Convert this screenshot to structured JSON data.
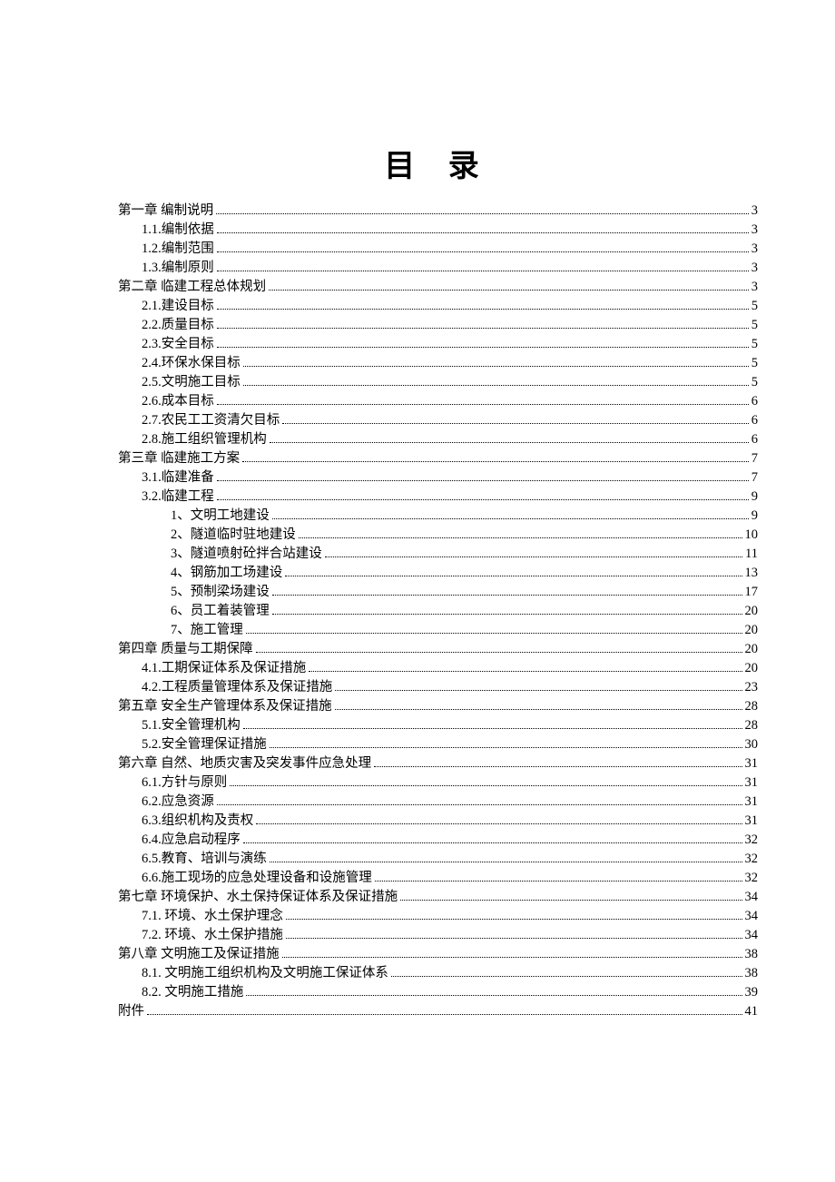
{
  "title": "目 录",
  "toc": [
    {
      "level": 0,
      "label": "第一章  编制说明",
      "page": "3"
    },
    {
      "level": 1,
      "label": "1.1.编制依据",
      "page": "3"
    },
    {
      "level": 1,
      "label": "1.2.编制范围",
      "page": "3"
    },
    {
      "level": 1,
      "label": "1.3.编制原则",
      "page": "3"
    },
    {
      "level": 0,
      "label": "第二章  临建工程总体规划",
      "page": "3"
    },
    {
      "level": 1,
      "label": "2.1.建设目标",
      "page": "5"
    },
    {
      "level": 1,
      "label": "2.2.质量目标",
      "page": "5"
    },
    {
      "level": 1,
      "label": "2.3.安全目标",
      "page": "5"
    },
    {
      "level": 1,
      "label": "2.4.环保水保目标",
      "page": "5"
    },
    {
      "level": 1,
      "label": "2.5.文明施工目标",
      "page": "5"
    },
    {
      "level": 1,
      "label": "2.6.成本目标",
      "page": "6"
    },
    {
      "level": 1,
      "label": "2.7.农民工工资清欠目标",
      "page": "6"
    },
    {
      "level": 1,
      "label": "2.8.施工组织管理机构",
      "page": "6"
    },
    {
      "level": 0,
      "label": "第三章  临建施工方案",
      "page": "7"
    },
    {
      "level": 1,
      "label": "3.1.临建准备",
      "page": "7"
    },
    {
      "level": 1,
      "label": "3.2.临建工程",
      "page": "9"
    },
    {
      "level": 2,
      "label": "1、文明工地建设",
      "page": "9"
    },
    {
      "level": 2,
      "label": "2、隧道临时驻地建设",
      "page": "10"
    },
    {
      "level": 2,
      "label": "3、隧道喷射砼拌合站建设",
      "page": "11"
    },
    {
      "level": 2,
      "label": "4、钢筋加工场建设",
      "page": "13"
    },
    {
      "level": 2,
      "label": "5、预制梁场建设",
      "page": "17"
    },
    {
      "level": 2,
      "label": "6、员工着装管理",
      "page": "20"
    },
    {
      "level": 2,
      "label": "7、施工管理",
      "page": "20"
    },
    {
      "level": 0,
      "label": "第四章  质量与工期保障",
      "page": "20"
    },
    {
      "level": 1,
      "label": "4.1.工期保证体系及保证措施",
      "page": "20"
    },
    {
      "level": 1,
      "label": "4.2.工程质量管理体系及保证措施",
      "page": "23"
    },
    {
      "level": 0,
      "label": "第五章  安全生产管理体系及保证措施",
      "page": "28"
    },
    {
      "level": 1,
      "label": "5.1.安全管理机构",
      "page": "28"
    },
    {
      "level": 1,
      "label": "5.2.安全管理保证措施",
      "page": "30"
    },
    {
      "level": 0,
      "label": "第六章  自然、地质灾害及突发事件应急处理",
      "page": "31"
    },
    {
      "level": 1,
      "label": "6.1.方针与原则",
      "page": "31"
    },
    {
      "level": 1,
      "label": "6.2.应急资源",
      "page": "31"
    },
    {
      "level": 1,
      "label": "6.3.组织机构及责权",
      "page": "31"
    },
    {
      "level": 1,
      "label": "6.4.应急启动程序",
      "page": "32"
    },
    {
      "level": 1,
      "label": "6.5.教育、培训与演练",
      "page": "32"
    },
    {
      "level": 1,
      "label": "6.6.施工现场的应急处理设备和设施管理",
      "page": "32"
    },
    {
      "level": 0,
      "label": "第七章  环境保护、水土保持保证体系及保证措施",
      "page": "34"
    },
    {
      "level": 1,
      "label": "7.1. 环境、水土保护理念",
      "page": "34"
    },
    {
      "level": 1,
      "label": "7.2. 环境、水土保护措施",
      "page": "34"
    },
    {
      "level": 0,
      "label": "第八章  文明施工及保证措施",
      "page": "38"
    },
    {
      "level": 1,
      "label": "8.1. 文明施工组织机构及文明施工保证体系",
      "page": "38"
    },
    {
      "level": 1,
      "label": "8.2. 文明施工措施",
      "page": "39"
    },
    {
      "level": 0,
      "label": "附件",
      "page": "41"
    }
  ]
}
